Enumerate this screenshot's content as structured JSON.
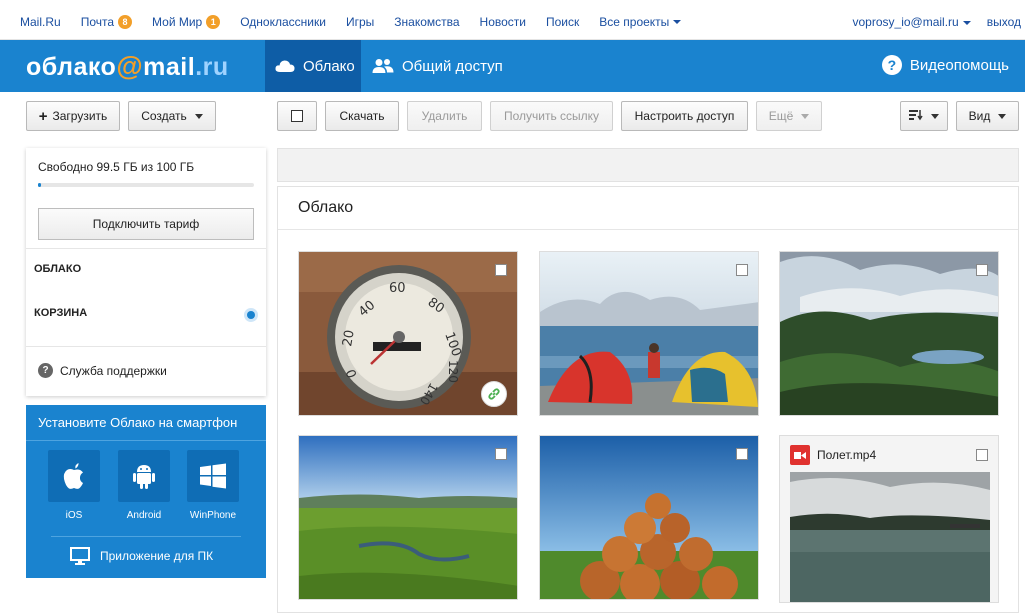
{
  "portal": {
    "links": [
      {
        "label": "Mail.Ru"
      },
      {
        "label": "Почта",
        "badge": "8"
      },
      {
        "label": "Мой Мир",
        "badge": "1"
      },
      {
        "label": "Одноклассники"
      },
      {
        "label": "Игры"
      },
      {
        "label": "Знакомства"
      },
      {
        "label": "Новости"
      },
      {
        "label": "Поиск"
      },
      {
        "label": "Все проекты"
      }
    ],
    "user": "voprosy_io@mail.ru",
    "logout": "выход"
  },
  "header": {
    "logo_word": "облако",
    "logo_at": "@",
    "logo_mail": "mail",
    "logo_ru": ".ru",
    "tabs": [
      {
        "label": "Облако",
        "icon": "cloud-icon",
        "active": true
      },
      {
        "label": "Общий доступ",
        "icon": "users-icon",
        "active": false
      }
    ],
    "help_label": "Видеопомощь",
    "help_icon_glyph": "?"
  },
  "toolbar": {
    "upload_plus": "+",
    "upload_label": "Загрузить",
    "create_label": "Создать",
    "download_label": "Скачать",
    "delete_label": "Удалить",
    "get_link_label": "Получить ссылку",
    "access_label": "Настроить доступ",
    "more_label": "Ещё",
    "view_label": "Вид"
  },
  "sidebar": {
    "quota_text": "Свободно 99.5 ГБ из 100 ГБ",
    "quota_used_fraction": 0.005,
    "tariff_label": "Подключить тариф",
    "folders": [
      {
        "label": "ОБЛАКО"
      },
      {
        "label": "КОРЗИНА"
      }
    ],
    "support_label": "Служба поддержки",
    "support_icon_glyph": "?"
  },
  "promo": {
    "title": "Установите Облако на смартфон",
    "apps": [
      {
        "label": "iOS",
        "icon": "apple-icon"
      },
      {
        "label": "Android",
        "icon": "android-icon"
      },
      {
        "label": "WinPhone",
        "icon": "windows-icon"
      }
    ],
    "pc_label": "Приложение для ПК"
  },
  "main": {
    "title": "Облако",
    "video_name": "Полет.mp4"
  },
  "colors": {
    "brand_blue": "#1a83cf",
    "active_tab": "#0e5da6",
    "accent_orange": "#f29f29",
    "link_blue": "#1b4fa0"
  }
}
